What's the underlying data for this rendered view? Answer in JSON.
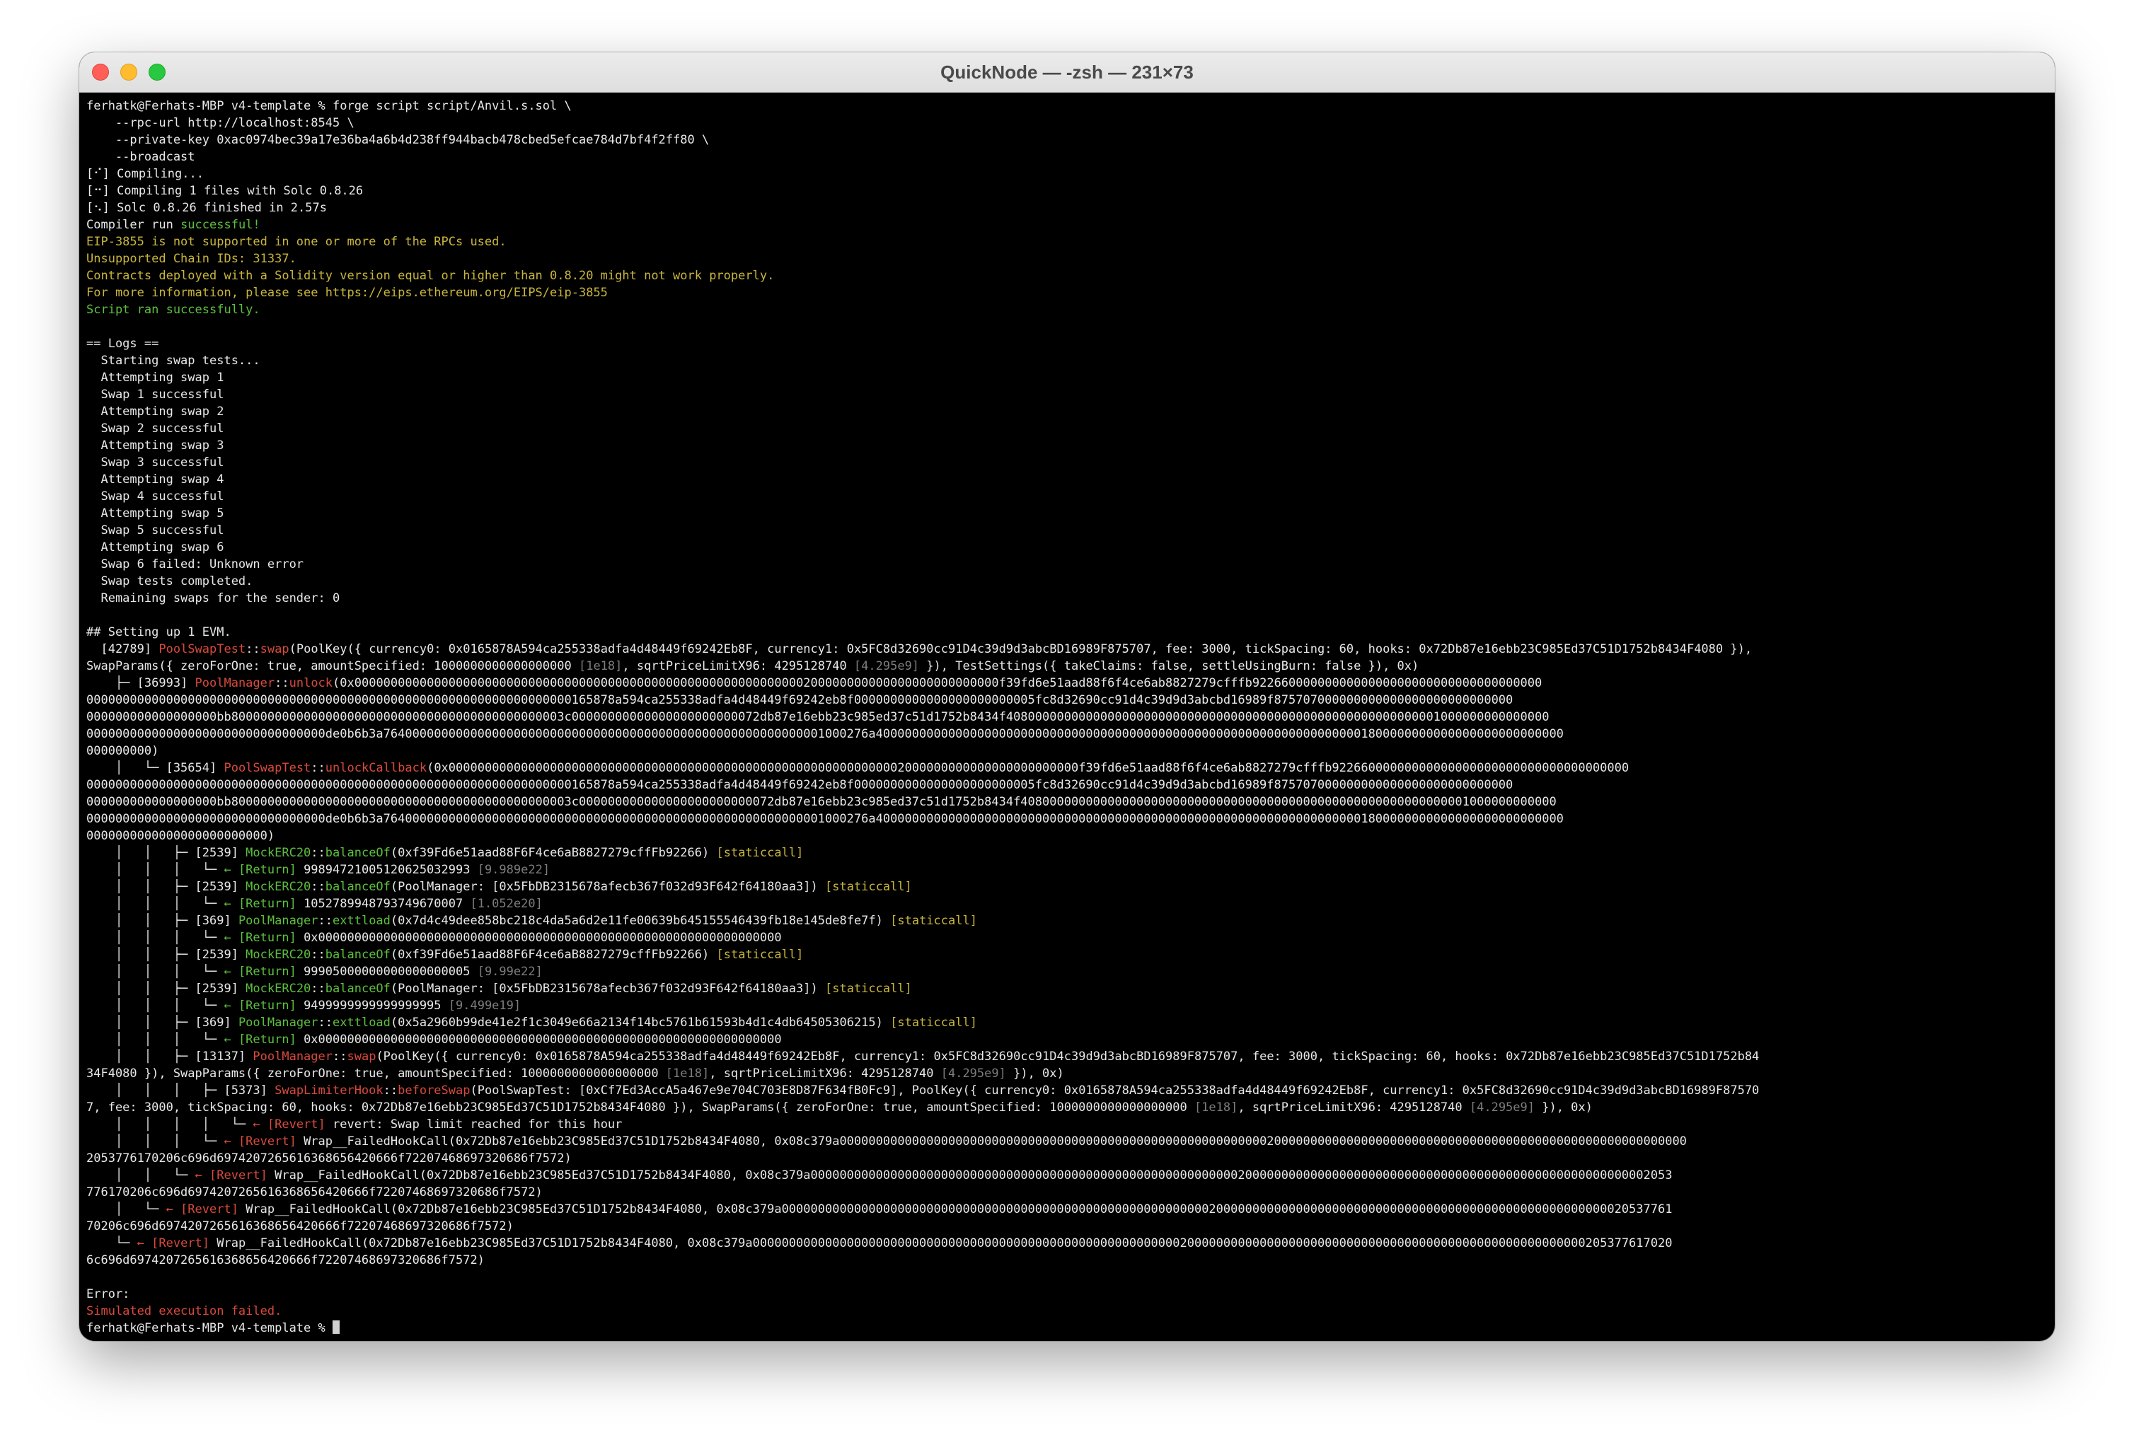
{
  "window": {
    "title": "QuickNode — -zsh — 231×73"
  },
  "terminal": {
    "lines": [
      [
        [
          "w",
          "ferhatk@Ferhats-MBP v4-template % forge script script/Anvil.s.sol \\"
        ]
      ],
      [
        [
          "w",
          "    --rpc-url http://localhost:8545 \\"
        ]
      ],
      [
        [
          "w",
          "    --private-key 0xac0974bec39a17e36ba4a6b4d238ff944bacb478cbed5efcae784d7bf4f2ff80 \\"
        ]
      ],
      [
        [
          "w",
          "    --broadcast"
        ]
      ],
      [
        [
          "w",
          "[⠊] Compiling..."
        ]
      ],
      [
        [
          "w",
          "[⠒] Compiling 1 files with Solc 0.8.26"
        ]
      ],
      [
        [
          "w",
          "[⠢] Solc 0.8.26 finished in 2.57s"
        ]
      ],
      [
        [
          "w",
          "Compiler run "
        ],
        [
          "g",
          "successful!"
        ]
      ],
      [
        [
          "y",
          "EIP-3855 is not supported in one or more of the RPCs used."
        ]
      ],
      [
        [
          "y",
          "Unsupported Chain IDs: 31337."
        ]
      ],
      [
        [
          "y",
          "Contracts deployed with a Solidity version equal or higher than 0.8.20 might not work properly."
        ]
      ],
      [
        [
          "y",
          "For more information, please see https://eips.ethereum.org/EIPS/eip-3855"
        ]
      ],
      [
        [
          "g",
          "Script ran successfully."
        ]
      ],
      [
        [
          "w",
          ""
        ]
      ],
      [
        [
          "w",
          "== Logs =="
        ]
      ],
      [
        [
          "w",
          "  Starting swap tests..."
        ]
      ],
      [
        [
          "w",
          "  Attempting swap 1"
        ]
      ],
      [
        [
          "w",
          "  Swap 1 successful"
        ]
      ],
      [
        [
          "w",
          "  Attempting swap 2"
        ]
      ],
      [
        [
          "w",
          "  Swap 2 successful"
        ]
      ],
      [
        [
          "w",
          "  Attempting swap 3"
        ]
      ],
      [
        [
          "w",
          "  Swap 3 successful"
        ]
      ],
      [
        [
          "w",
          "  Attempting swap 4"
        ]
      ],
      [
        [
          "w",
          "  Swap 4 successful"
        ]
      ],
      [
        [
          "w",
          "  Attempting swap 5"
        ]
      ],
      [
        [
          "w",
          "  Swap 5 successful"
        ]
      ],
      [
        [
          "w",
          "  Attempting swap 6"
        ]
      ],
      [
        [
          "w",
          "  Swap 6 failed: Unknown error"
        ]
      ],
      [
        [
          "w",
          "  Swap tests completed."
        ]
      ],
      [
        [
          "w",
          "  Remaining swaps for the sender: 0"
        ]
      ],
      [
        [
          "w",
          ""
        ]
      ],
      [
        [
          "w",
          "## Setting up 1 EVM."
        ]
      ],
      [
        [
          "w",
          "  [42789] "
        ],
        [
          "r",
          "PoolSwapTest"
        ],
        [
          "w",
          "::"
        ],
        [
          "r",
          "swap"
        ],
        [
          "w",
          "(PoolKey({ currency0: 0x0165878A594ca255338adfa4d48449f69242Eb8F, currency1: 0x5FC8d32690cc91D4c39d9d3abcBD16989F875707, fee: 3000, tickSpacing: 60, hooks: 0x72Db87e16ebb23C985Ed37C51D1752b8434F4080 }),"
        ]
      ],
      [
        [
          "w",
          "SwapParams({ zeroForOne: true, amountSpecified: 1000000000000000000 "
        ],
        [
          "d",
          "[1e18]"
        ],
        [
          "w",
          ", sqrtPriceLimitX96: 4295128740 "
        ],
        [
          "d",
          "[4.295e9]"
        ],
        [
          "w",
          " }), TestSettings({ takeClaims: false, settleUsingBurn: false }), 0x)"
        ]
      ],
      [
        [
          "w",
          "    ├─ [36993] "
        ],
        [
          "r",
          "PoolManager"
        ],
        [
          "w",
          "::"
        ],
        [
          "r",
          "unlock"
        ],
        [
          "w",
          "(0x00000000000000000000000000000000000000000000000000000000000000200000000000000000000000000f39fd6e51aad88f6f4ce6ab8827279cfffb9226600000000000000000000000000000000000"
        ]
      ],
      [
        [
          "w",
          "0000000000000000000000000000000000000000000000000000000000000000000165878a594ca255338adfa4d48449f69242eb8f0000000000000000000000005fc8d32690cc91d4c39d9d3abcbd16989f875707000000000000000000000000000"
        ]
      ],
      [
        [
          "w",
          "000000000000000000bb8000000000000000000000000000000000000000000003c00000000000000000000000072db87e16ebb23c985ed37c51d1752b8434f408000000000000000000000000000000000000000000000000000000001000000000000000"
        ]
      ],
      [
        [
          "w",
          "000000000000000000000000000000000de0b6b3a7640000000000000000000000000000000000000000000000000000000001000276a40000000000000000000000000000000000000000000000000000000000000000001800000000000000000000000000"
        ]
      ],
      [
        [
          "w",
          "000000000)"
        ]
      ],
      [
        [
          "w",
          "    │   └─ [35654] "
        ],
        [
          "r",
          "PoolSwapTest"
        ],
        [
          "w",
          "::"
        ],
        [
          "r",
          "unlockCallback"
        ],
        [
          "w",
          "(0x000000000000000000000000000000000000000000000000000000000000002000000000000000000000000f39fd6e51aad88f6f4ce6ab8827279cfffb92266000000000000000000000000000000000000"
        ]
      ],
      [
        [
          "w",
          "0000000000000000000000000000000000000000000000000000000000000000000165878a594ca255338adfa4d48449f69242eb8f0000000000000000000000005fc8d32690cc91d4c39d9d3abcbd16989f875707000000000000000000000000000"
        ]
      ],
      [
        [
          "w",
          "000000000000000000bb80000000000000000000000000000000000000000000003c000000000000000000000000072db87e16ebb23c985ed37c51d1752b8434f40800000000000000000000000000000000000000000000000000000000001000000000000"
        ]
      ],
      [
        [
          "w",
          "000000000000000000000000000000000de0b6b3a7640000000000000000000000000000000000000000000000000000000001000276a40000000000000000000000000000000000000000000000000000000000000000001800000000000000000000000000"
        ]
      ],
      [
        [
          "w",
          "0000000000000000000000000)"
        ]
      ],
      [
        [
          "w",
          "    │   │   ├─ [2539] "
        ],
        [
          "g",
          "MockERC20"
        ],
        [
          "w",
          "::"
        ],
        [
          "g",
          "balanceOf"
        ],
        [
          "w",
          "(0xf39Fd6e51aad88F6F4ce6aB8827279cffFb92266) "
        ],
        [
          "y",
          "[staticcall]"
        ]
      ],
      [
        [
          "w",
          "    │   │   │   └─ "
        ],
        [
          "g",
          "← [Return]"
        ],
        [
          "w",
          " 99894721005120625032993 "
        ],
        [
          "d",
          "[9.989e22]"
        ]
      ],
      [
        [
          "w",
          "    │   │   ├─ [2539] "
        ],
        [
          "g",
          "MockERC20"
        ],
        [
          "w",
          "::"
        ],
        [
          "g",
          "balanceOf"
        ],
        [
          "w",
          "(PoolManager: [0x5FbDB2315678afecb367f032d93F642f64180aa3]) "
        ],
        [
          "y",
          "[staticcall]"
        ]
      ],
      [
        [
          "w",
          "    │   │   │   └─ "
        ],
        [
          "g",
          "← [Return]"
        ],
        [
          "w",
          " 1052789948793749670007 "
        ],
        [
          "d",
          "[1.052e20]"
        ]
      ],
      [
        [
          "w",
          "    │   │   ├─ [369] "
        ],
        [
          "g",
          "PoolManager"
        ],
        [
          "w",
          "::"
        ],
        [
          "g",
          "exttload"
        ],
        [
          "w",
          "(0x7d4c49dee858bc218c4da5a6d2e11fe00639b645155546439fb18e145de8fe7f) "
        ],
        [
          "y",
          "[staticcall]"
        ]
      ],
      [
        [
          "w",
          "    │   │   │   └─ "
        ],
        [
          "g",
          "← [Return]"
        ],
        [
          "w",
          " 0x0000000000000000000000000000000000000000000000000000000000000000"
        ]
      ],
      [
        [
          "w",
          "    │   │   ├─ [2539] "
        ],
        [
          "g",
          "MockERC20"
        ],
        [
          "w",
          "::"
        ],
        [
          "g",
          "balanceOf"
        ],
        [
          "w",
          "(0xf39Fd6e51aad88F6F4ce6aB8827279cffFb92266) "
        ],
        [
          "y",
          "[staticcall]"
        ]
      ],
      [
        [
          "w",
          "    │   │   │   └─ "
        ],
        [
          "g",
          "← [Return]"
        ],
        [
          "w",
          " 99905000000000000000005 "
        ],
        [
          "d",
          "[9.99e22]"
        ]
      ],
      [
        [
          "w",
          "    │   │   ├─ [2539] "
        ],
        [
          "g",
          "MockERC20"
        ],
        [
          "w",
          "::"
        ],
        [
          "g",
          "balanceOf"
        ],
        [
          "w",
          "(PoolManager: [0x5FbDB2315678afecb367f032d93F642f64180aa3]) "
        ],
        [
          "y",
          "[staticcall]"
        ]
      ],
      [
        [
          "w",
          "    │   │   │   └─ "
        ],
        [
          "g",
          "← [Return]"
        ],
        [
          "w",
          " 9499999999999999995 "
        ],
        [
          "d",
          "[9.499e19]"
        ]
      ],
      [
        [
          "w",
          "    │   │   ├─ [369] "
        ],
        [
          "g",
          "PoolManager"
        ],
        [
          "w",
          "::"
        ],
        [
          "g",
          "exttload"
        ],
        [
          "w",
          "(0x5a2960b99de41e2f1c3049e66a2134f14bc5761b61593b4d1c4db64505306215) "
        ],
        [
          "y",
          "[staticcall]"
        ]
      ],
      [
        [
          "w",
          "    │   │   │   └─ "
        ],
        [
          "g",
          "← [Return]"
        ],
        [
          "w",
          " 0x0000000000000000000000000000000000000000000000000000000000000000"
        ]
      ],
      [
        [
          "w",
          "    │   │   ├─ [13137] "
        ],
        [
          "r",
          "PoolManager"
        ],
        [
          "w",
          "::"
        ],
        [
          "r",
          "swap"
        ],
        [
          "w",
          "(PoolKey({ currency0: 0x0165878A594ca255338adfa4d48449f69242Eb8F, currency1: 0x5FC8d32690cc91D4c39d9d3abcBD16989F875707, fee: 3000, tickSpacing: 60, hooks: 0x72Db87e16ebb23C985Ed37C51D1752b84"
        ]
      ],
      [
        [
          "w",
          "34F4080 }), SwapParams({ zeroForOne: true, amountSpecified: 1000000000000000000 "
        ],
        [
          "d",
          "[1e18]"
        ],
        [
          "w",
          ", sqrtPriceLimitX96: 4295128740 "
        ],
        [
          "d",
          "[4.295e9]"
        ],
        [
          "w",
          " }), 0x)"
        ]
      ],
      [
        [
          "w",
          "    │   │   │   ├─ [5373] "
        ],
        [
          "r",
          "SwapLimiterHook"
        ],
        [
          "w",
          "::"
        ],
        [
          "r",
          "beforeSwap"
        ],
        [
          "w",
          "(PoolSwapTest: [0xCf7Ed3AccA5a467e9e704C703E8D87F634fB0Fc9], PoolKey({ currency0: 0x0165878A594ca255338adfa4d48449f69242Eb8F, currency1: 0x5FC8d32690cc91D4c39d9d3abcBD16989F87570"
        ]
      ],
      [
        [
          "w",
          "7, fee: 3000, tickSpacing: 60, hooks: 0x72Db87e16ebb23C985Ed37C51D1752b8434F4080 }), SwapParams({ zeroForOne: true, amountSpecified: 1000000000000000000 "
        ],
        [
          "d",
          "[1e18]"
        ],
        [
          "w",
          ", sqrtPriceLimitX96: 4295128740 "
        ],
        [
          "d",
          "[4.295e9]"
        ],
        [
          "w",
          " }), 0x)"
        ]
      ],
      [
        [
          "w",
          "    │   │   │   │   └─ "
        ],
        [
          "r",
          "← [Revert]"
        ],
        [
          "w",
          " revert: Swap limit reached for this hour"
        ]
      ],
      [
        [
          "w",
          "    │   │   │   └─ "
        ],
        [
          "r",
          "← [Revert]"
        ],
        [
          "w",
          " Wrap__FailedHookCall(0x72Db87e16ebb23C985Ed37C51D1752b8434F4080, 0x08c379a000000000000000000000000000000000000000000000000000000000002000000000000000000000000000000000000000000000000000000000"
        ]
      ],
      [
        [
          "w",
          "2053776170206c696d6974207265616368656420666f72207468697320686f7572)"
        ]
      ],
      [
        [
          "w",
          "    │   │   └─ "
        ],
        [
          "r",
          "← [Revert]"
        ],
        [
          "w",
          " Wrap__FailedHookCall(0x72Db87e16ebb23C985Ed37C51D1752b8434F4080, 0x08c379a00000000000000000000000000000000000000000000000000000000000200000000000000000000000000000000000000000000000000000002053"
        ]
      ],
      [
        [
          "w",
          "776170206c696d6974207265616368656420666f72207468697320686f7572)"
        ]
      ],
      [
        [
          "w",
          "    │   └─ "
        ],
        [
          "r",
          "← [Revert]"
        ],
        [
          "w",
          " Wrap__FailedHookCall(0x72Db87e16ebb23C985Ed37C51D1752b8434F4080, 0x08c379a000000000000000000000000000000000000000000000000000000000002000000000000000000000000000000000000000000000000000000020537761"
        ]
      ],
      [
        [
          "w",
          "70206c696d6974207265616368656420666f72207468697320686f7572)"
        ]
      ],
      [
        [
          "w",
          "    └─ "
        ],
        [
          "r",
          "← [Revert]"
        ],
        [
          "w",
          " Wrap__FailedHookCall(0x72Db87e16ebb23C985Ed37C51D1752b8434F4080, 0x08c379a0000000000000000000000000000000000000000000000000000000000020000000000000000000000000000000000000000000000000000000205377617020"
        ]
      ],
      [
        [
          "w",
          "6c696d6974207265616368656420666f72207468697320686f7572)"
        ]
      ],
      [
        [
          "w",
          ""
        ]
      ],
      [
        [
          "w",
          "Error:"
        ]
      ],
      [
        [
          "r",
          "Simulated execution failed."
        ]
      ],
      [
        [
          "w",
          "ferhatk@Ferhats-MBP v4-template % "
        ]
      ]
    ]
  },
  "colors": {
    "success": "#5dbf3e",
    "warning": "#c8b53c",
    "error": "#d94a3d",
    "dim": "#7d7d7d",
    "text": "#e8e8e8",
    "background": "#000000"
  }
}
